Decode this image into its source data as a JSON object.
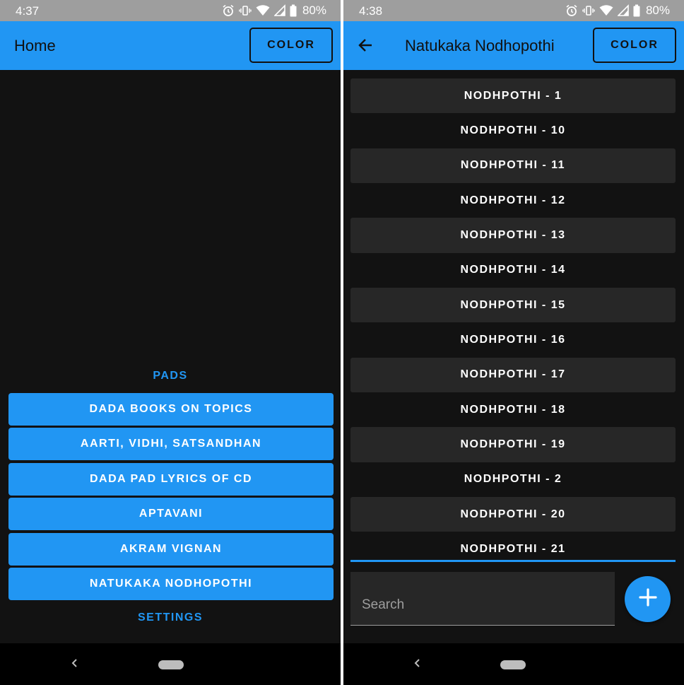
{
  "colors": {
    "accent": "#2196f3",
    "background": "#121212",
    "surface": "#272727",
    "statusbar": "#9e9e9e"
  },
  "left": {
    "status": {
      "time": "4:37",
      "battery": "80%"
    },
    "appbar": {
      "title": "Home",
      "color_button": "COLOR"
    },
    "pads_label": "PADS",
    "menu": [
      {
        "label": "DADA BOOKS ON TOPICS"
      },
      {
        "label": "AARTI, VIDHI, SATSANDHAN"
      },
      {
        "label": "DADA PAD LYRICS OF CD"
      },
      {
        "label": "APTAVANI"
      },
      {
        "label": "AKRAM VIGNAN"
      },
      {
        "label": "NATUKAKA NODHOPOTHI"
      }
    ],
    "settings_label": "SETTINGS",
    "nav": {
      "back_icon": "chevron-left-icon",
      "home_icon": "home-pill-icon"
    }
  },
  "right": {
    "status": {
      "time": "4:38",
      "battery": "80%"
    },
    "appbar": {
      "title": "Natukaka Nodhopothi",
      "color_button": "COLOR",
      "back_icon": "arrow-left-icon"
    },
    "list": [
      {
        "label": "NODHPOTHI - 1"
      },
      {
        "label": "NODHPOTHI - 10"
      },
      {
        "label": "NODHPOTHI - 11"
      },
      {
        "label": "NODHPOTHI - 12"
      },
      {
        "label": "NODHPOTHI - 13"
      },
      {
        "label": "NODHPOTHI - 14"
      },
      {
        "label": "NODHPOTHI - 15"
      },
      {
        "label": "NODHPOTHI - 16"
      },
      {
        "label": "NODHPOTHI - 17"
      },
      {
        "label": "NODHPOTHI - 18"
      },
      {
        "label": "NODHPOTHI - 19"
      },
      {
        "label": "NODHPOTHI - 2"
      },
      {
        "label": "NODHPOTHI - 20"
      },
      {
        "label": "NODHPOTHI - 21"
      }
    ],
    "search": {
      "placeholder": "Search",
      "value": ""
    },
    "fab_icon": "plus-icon"
  }
}
